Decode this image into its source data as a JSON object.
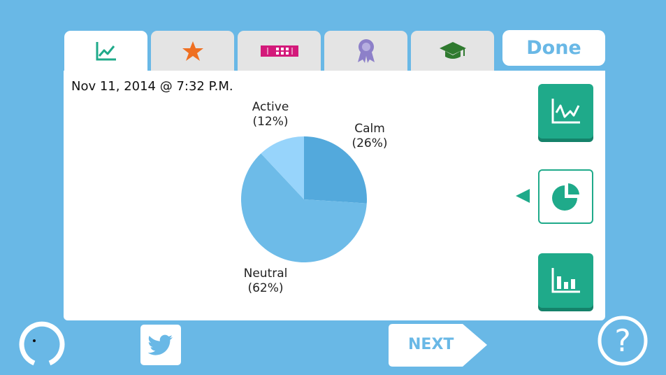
{
  "tabs": [
    {
      "icon": "line-chart-icon",
      "active": true
    },
    {
      "icon": "star-icon",
      "active": false
    },
    {
      "icon": "ticket-icon",
      "active": false
    },
    {
      "icon": "ribbon-award-icon",
      "active": false
    },
    {
      "icon": "graduation-cap-icon",
      "active": false
    }
  ],
  "done_label": "Done",
  "timestamp": "Nov 11, 2014 @ 7:32 P.M.",
  "chart_data": {
    "type": "pie",
    "slices": [
      {
        "label": "Calm",
        "percent_label": "(26%)",
        "value": 26,
        "color": "#53a9dc"
      },
      {
        "label": "Neutral",
        "percent_label": "(62%)",
        "value": 62,
        "color": "#6dbbe8"
      },
      {
        "label": "Active",
        "percent_label": "(12%)",
        "value": 12,
        "color": "#97d4fb"
      }
    ]
  },
  "side_buttons": [
    {
      "icon": "line-graph-view-icon",
      "selected": false
    },
    {
      "icon": "pie-chart-view-icon",
      "selected": true
    },
    {
      "icon": "bar-chart-view-icon",
      "selected": false
    }
  ],
  "next_label": "NEXT",
  "colors": {
    "background": "#69b8e6",
    "accent": "#1faa8a",
    "tab_inactive": "#e4e4e4"
  }
}
